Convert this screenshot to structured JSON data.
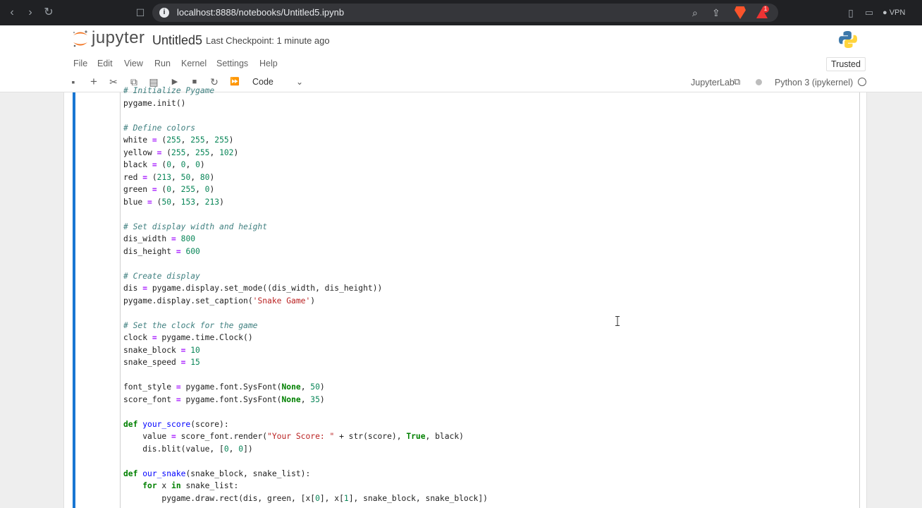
{
  "browser": {
    "url": "localhost:8888/notebooks/Untitled5.ipynb",
    "vpn_label": "VPN",
    "brave_badge_count": "1"
  },
  "header": {
    "app_name": "jupyter",
    "notebook_title": "Untitled5",
    "checkpoint": "Last Checkpoint: 1 minute ago"
  },
  "menu": {
    "items": [
      "File",
      "Edit",
      "View",
      "Run",
      "Kernel",
      "Settings",
      "Help"
    ],
    "trusted_label": "Trusted"
  },
  "toolbar": {
    "cell_type": "Code",
    "jupyterlab_label": "JupyterLab",
    "kernel_name": "Python 3 (ipykernel)"
  },
  "colors": {
    "active_cell": "#1976d2",
    "comment": "#408080",
    "number": "#098658",
    "string": "#ba2121",
    "keyword": "#008000"
  },
  "code_lines": [
    "# Initialize Pygame",
    "pygame.init()",
    "",
    "# Define colors",
    "white = (255, 255, 255)",
    "yellow = (255, 255, 102)",
    "black = (0, 0, 0)",
    "red = (213, 50, 80)",
    "green = (0, 255, 0)",
    "blue = (50, 153, 213)",
    "",
    "# Set display width and height",
    "dis_width = 800",
    "dis_height = 600",
    "",
    "# Create display",
    "dis = pygame.display.set_mode((dis_width, dis_height))",
    "pygame.display.set_caption('Snake Game')",
    "",
    "# Set the clock for the game",
    "clock = pygame.time.Clock()",
    "snake_block = 10",
    "snake_speed = 15",
    "",
    "font_style = pygame.font.SysFont(None, 50)",
    "score_font = pygame.font.SysFont(None, 35)",
    "",
    "def your_score(score):",
    "    value = score_font.render(\"Your Score: \" + str(score), True, black)",
    "    dis.blit(value, [0, 0])",
    "",
    "def our_snake(snake_block, snake_list):",
    "    for x in snake_list:",
    "        pygame.draw.rect(dis, green, [x[0], x[1], snake_block, snake_block])"
  ]
}
